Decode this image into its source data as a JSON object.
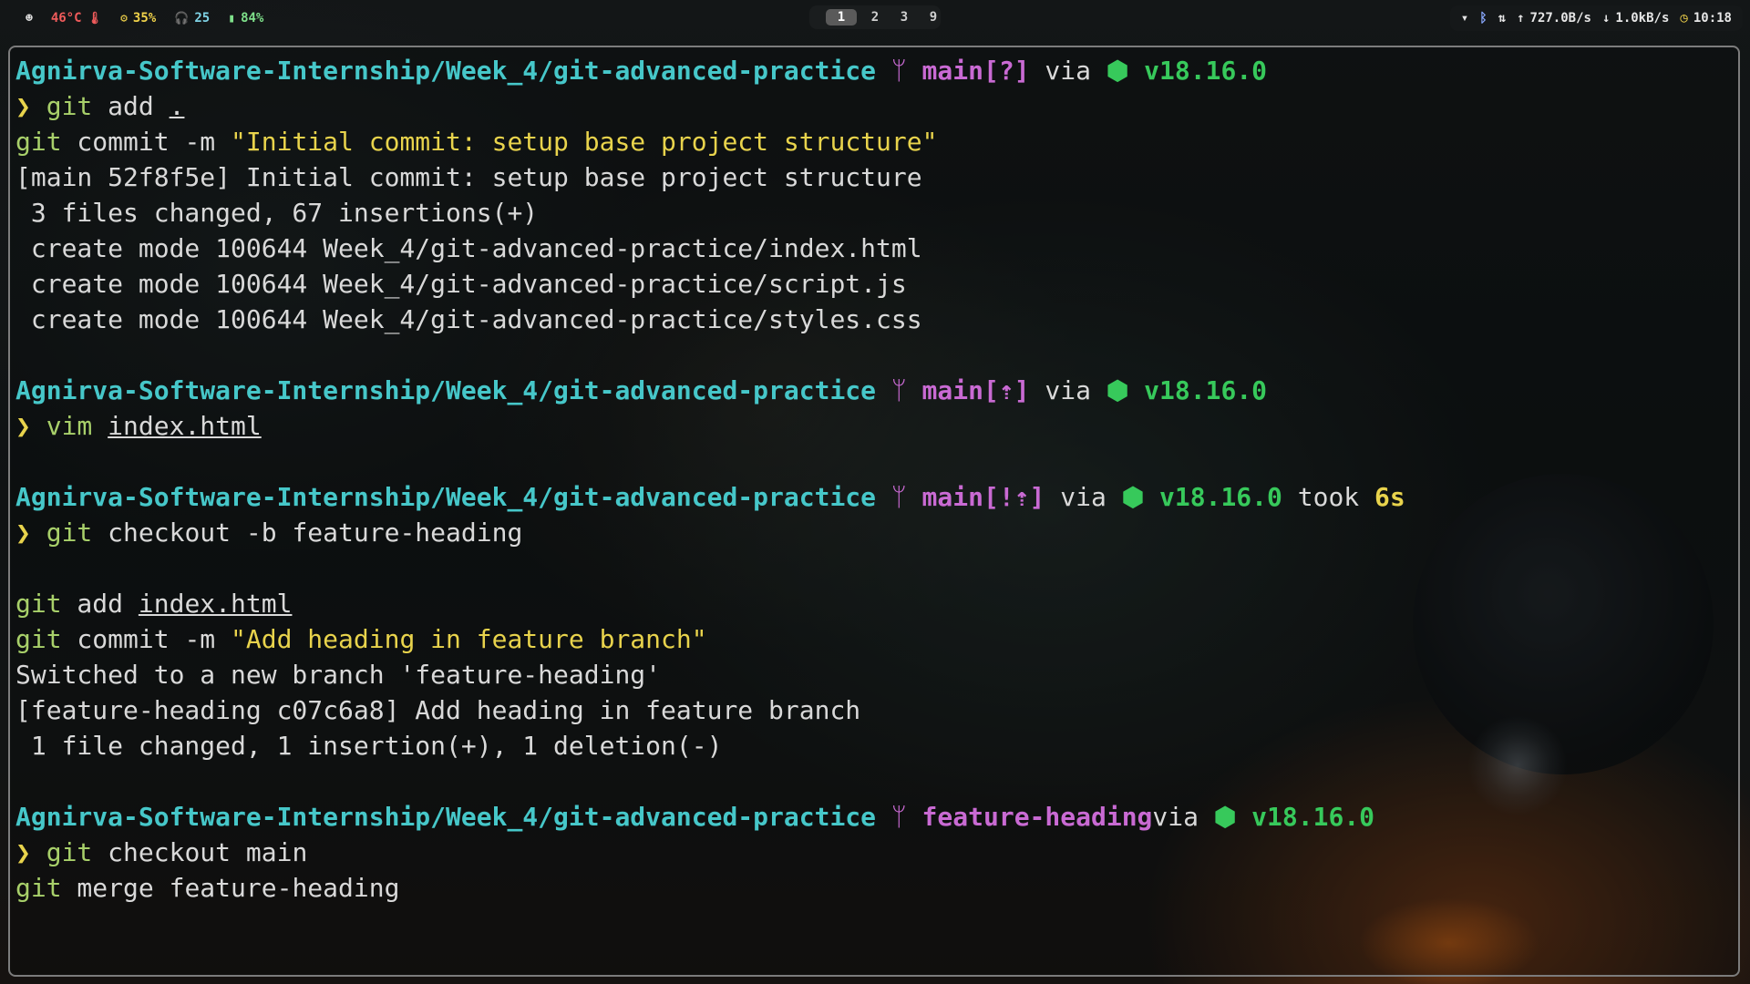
{
  "topbar": {
    "user_icon": "user-icon",
    "temperature": "46°C",
    "temp_icon": "thermometer-icon",
    "cpu": "35%",
    "cpu_icon": "cpu-icon",
    "volume": "25",
    "volume_icon": "headphones-icon",
    "battery": "84%",
    "battery_icon": "battery-icon",
    "workspaces": [
      "1",
      "2",
      "3",
      "9"
    ],
    "active_workspace": "1",
    "wifi_icon": "wifi-icon",
    "bluetooth_icon": "bluetooth-icon",
    "network_icon": "network-icon",
    "upload": "727.0B/s",
    "download": "1.0kB/s",
    "time": "10:18",
    "clock_icon": "clock-icon"
  },
  "terminal": {
    "prompt_path": "Agnirva-Software-Internship/Week_4/git-advanced-practice",
    "branch_glyph": "ᛘ",
    "node_glyph": "⬢",
    "node_version": "v18.16.0",
    "via": "via",
    "prompt_char": "❯",
    "block1": {
      "branch": "main[?]",
      "cmd1_git": "git",
      "cmd1_rest": " add ",
      "cmd1_arg": ".",
      "cmd2_git": "git",
      "cmd2_rest": " commit -m ",
      "cmd2_str": "\"Initial commit: setup base project structure\"",
      "out1": "[main 52f8f5e] Initial commit: setup base project structure",
      "out2": " 3 files changed, 67 insertions(+)",
      "out3": " create mode 100644 Week_4/git-advanced-practice/index.html",
      "out4": " create mode 100644 Week_4/git-advanced-practice/script.js",
      "out5": " create mode 100644 Week_4/git-advanced-practice/styles.css"
    },
    "block2": {
      "branch": "main[⇡]",
      "cmd": "vim",
      "arg": "index.html"
    },
    "block3": {
      "branch": "main[!⇡]",
      "took": "took",
      "duration": "6s",
      "cmd1_git": "git",
      "cmd1_rest": " checkout -b feature-heading",
      "cmd2_git": "git",
      "cmd2_rest": " add ",
      "cmd2_arg": "index.html",
      "cmd3_git": "git",
      "cmd3_rest": " commit -m ",
      "cmd3_str": "\"Add heading in feature branch\"",
      "out1": "Switched to a new branch 'feature-heading'",
      "out2": "[feature-heading c07c6a8] Add heading in feature branch",
      "out3": " 1 file changed, 1 insertion(+), 1 deletion(-)"
    },
    "block4": {
      "branch": "feature-heading",
      "cmd1_git": "git",
      "cmd1_rest": " checkout main",
      "cmd2_git": "git",
      "cmd2_rest": " merge feature-heading"
    }
  }
}
